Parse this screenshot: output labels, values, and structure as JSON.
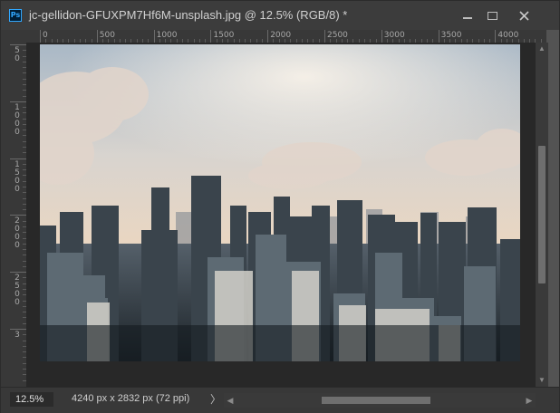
{
  "window": {
    "title": "jc-gellidon-GFUXPM7Hf6M-unsplash.jpg @ 12.5% (RGB/8) *",
    "app_icon_text": "Ps",
    "controls": {
      "minimize": "minimize-icon",
      "maximize": "maximize-icon",
      "close": "close-icon"
    }
  },
  "ruler_top": {
    "labels": [
      "0",
      "500",
      "1000",
      "1500",
      "2000",
      "2500",
      "3000",
      "3500",
      "4000"
    ]
  },
  "ruler_left": {
    "labels": [
      [
        "5",
        "0"
      ],
      [
        "1",
        "0",
        "0",
        "0"
      ],
      [
        "1",
        "5",
        "0",
        "0"
      ],
      [
        "2",
        "0",
        "0",
        "0"
      ],
      [
        "2",
        "5",
        "0",
        "0"
      ],
      [
        "3"
      ]
    ]
  },
  "status": {
    "zoom": "12.5%",
    "doc_size": "4240 px x 2832 px (72 ppi)",
    "arrow": "〉"
  },
  "colors": {
    "accent": "#31a8ff",
    "title_bg": "#3c3c3c",
    "canvas_bg": "#282828"
  }
}
